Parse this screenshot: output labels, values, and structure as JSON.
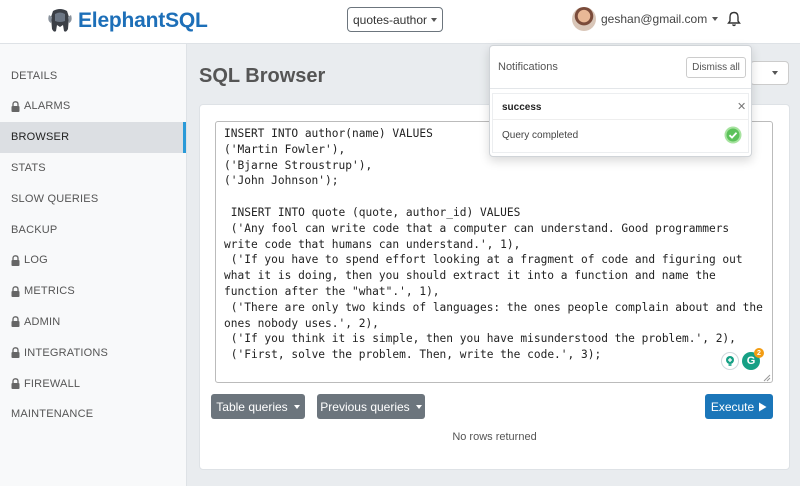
{
  "header": {
    "brand": "ElephantSQL",
    "instance_selector": "quotes-author",
    "user_email": "geshan@gmail.com"
  },
  "sidebar": {
    "items": [
      {
        "label": "DETAILS",
        "locked": false,
        "active": false
      },
      {
        "label": "ALARMS",
        "locked": true,
        "active": false
      },
      {
        "label": "BROWSER",
        "locked": false,
        "active": true
      },
      {
        "label": "STATS",
        "locked": false,
        "active": false
      },
      {
        "label": "SLOW QUERIES",
        "locked": false,
        "active": false
      },
      {
        "label": "BACKUP",
        "locked": false,
        "active": false
      },
      {
        "label": "LOG",
        "locked": true,
        "active": false
      },
      {
        "label": "METRICS",
        "locked": true,
        "active": false
      },
      {
        "label": "ADMIN",
        "locked": true,
        "active": false
      },
      {
        "label": "INTEGRATIONS",
        "locked": true,
        "active": false
      },
      {
        "label": "FIREWALL",
        "locked": true,
        "active": false
      },
      {
        "label": "MAINTENANCE",
        "locked": false,
        "active": false
      }
    ]
  },
  "main": {
    "title": "SQL Browser",
    "query": "INSERT INTO author(name) VALUES\n('Martin Fowler'),\n('Bjarne Stroustrup'),\n('John Johnson');\n\n INSERT INTO quote (quote, author_id) VALUES\n ('Any fool can write code that a computer can understand. Good programmers write code that humans can understand.', 1),\n ('If you have to spend effort looking at a fragment of code and figuring out what it is doing, then you should extract it into a function and name the function after the \"what\".', 1),\n ('There are only two kinds of languages: the ones people complain about and the ones nobody uses.', 2),\n ('If you think it is simple, then you have misunderstood the problem.', 2),\n ('First, solve the problem. Then, write the code.', 3);",
    "table_queries_label": "Table queries",
    "previous_queries_label": "Previous queries",
    "execute_label": "Execute",
    "result_text": "No rows returned",
    "grammarly_badge": "2",
    "grammarly_letter": "G"
  },
  "notifications": {
    "title": "Notifications",
    "dismiss_label": "Dismiss all",
    "items": [
      {
        "title": "success",
        "message": "Query completed"
      }
    ]
  },
  "colors": {
    "brand": "#1d6fb8",
    "active_indicator": "#2a9ad8",
    "execute": "#1b76b9",
    "secondary_button": "#6c757d",
    "success": "#3cb34a"
  }
}
